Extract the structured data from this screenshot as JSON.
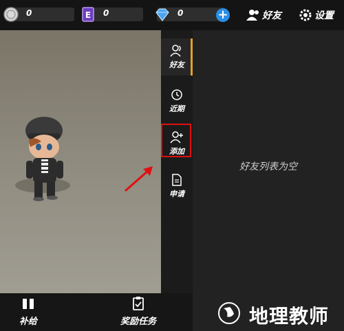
{
  "topbar": {
    "coins": "0",
    "energy": "0",
    "gems": "0",
    "friends_label": "好友",
    "settings_label": "设置"
  },
  "sidebar": {
    "tabs": [
      {
        "label": "好友"
      },
      {
        "label": "近期"
      },
      {
        "label": "添加"
      },
      {
        "label": "申请"
      }
    ]
  },
  "panel": {
    "empty_text": "好友列表为空"
  },
  "bottom": {
    "supply_label": "补给",
    "reward_label": "奖励任务"
  },
  "watermark": {
    "text": "地理教师"
  },
  "colors": {
    "accent": "#e8a028",
    "highlight": "#e01010",
    "plus": "#2a8ee6"
  }
}
